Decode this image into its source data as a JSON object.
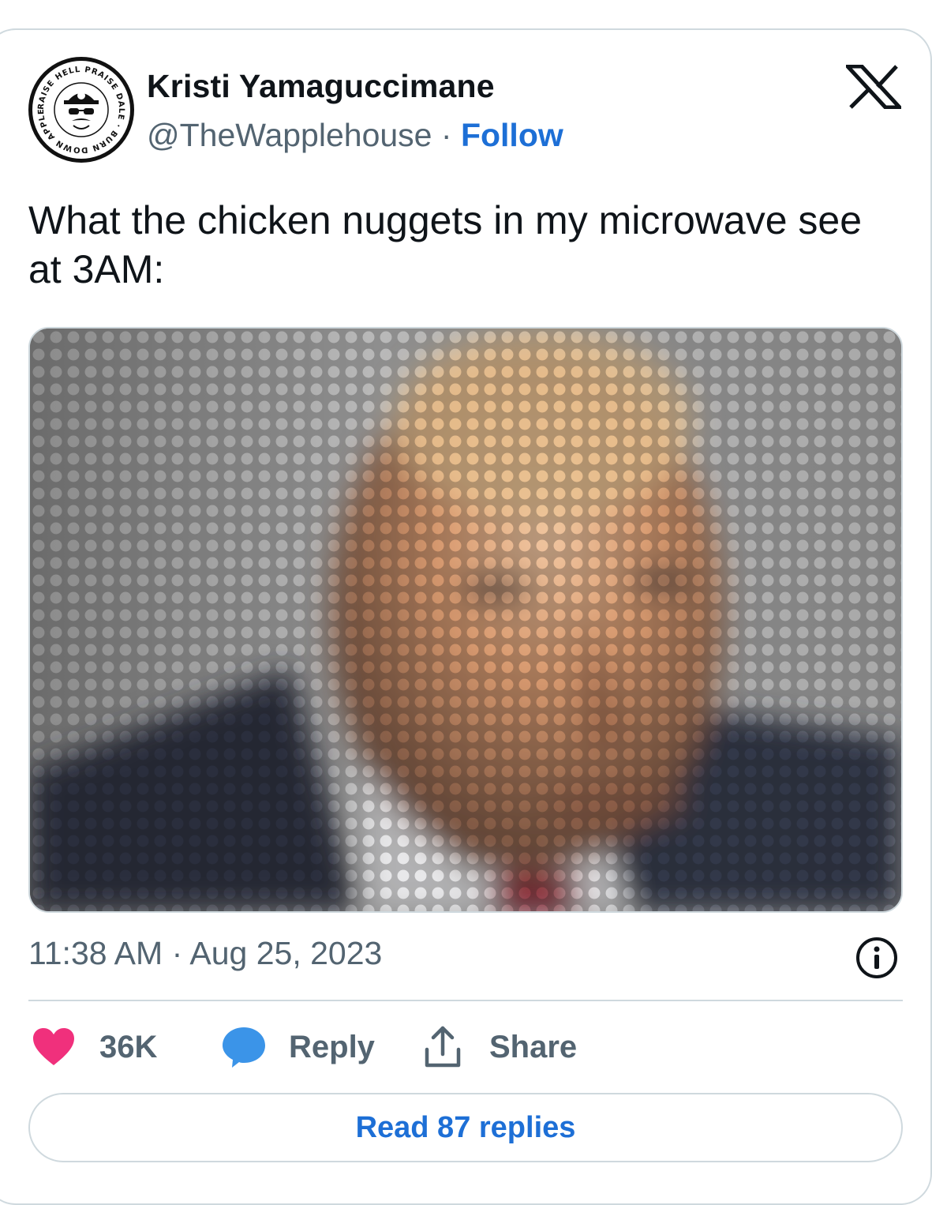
{
  "author": {
    "name": "Kristi Yamaguccimane",
    "handle": "@TheWapplehouse",
    "separator": "·",
    "follow_label": "Follow",
    "avatar_ring_text": "RAISE HELL PRAISE DALE · BURN DOWN APPLEBEE'S"
  },
  "tweet": {
    "text": "What the chicken nuggets in my microwave see at 3AM:",
    "time": "11:38 AM",
    "separator": "·",
    "date": "Aug 25, 2023"
  },
  "actions": {
    "like_count": "36K",
    "reply_label": "Reply",
    "share_label": "Share"
  },
  "replies_button": "Read 87 replies",
  "icons": {
    "logo": "x-logo-icon",
    "info": "info-icon",
    "like": "heart-icon",
    "reply": "speech-bubble-icon",
    "share": "share-upload-icon"
  },
  "colors": {
    "link": "#1d6fd6",
    "heart": "#f0307c",
    "reply_bubble": "#3b94e8",
    "secondary_text": "#536471",
    "border": "#cfd9de"
  }
}
